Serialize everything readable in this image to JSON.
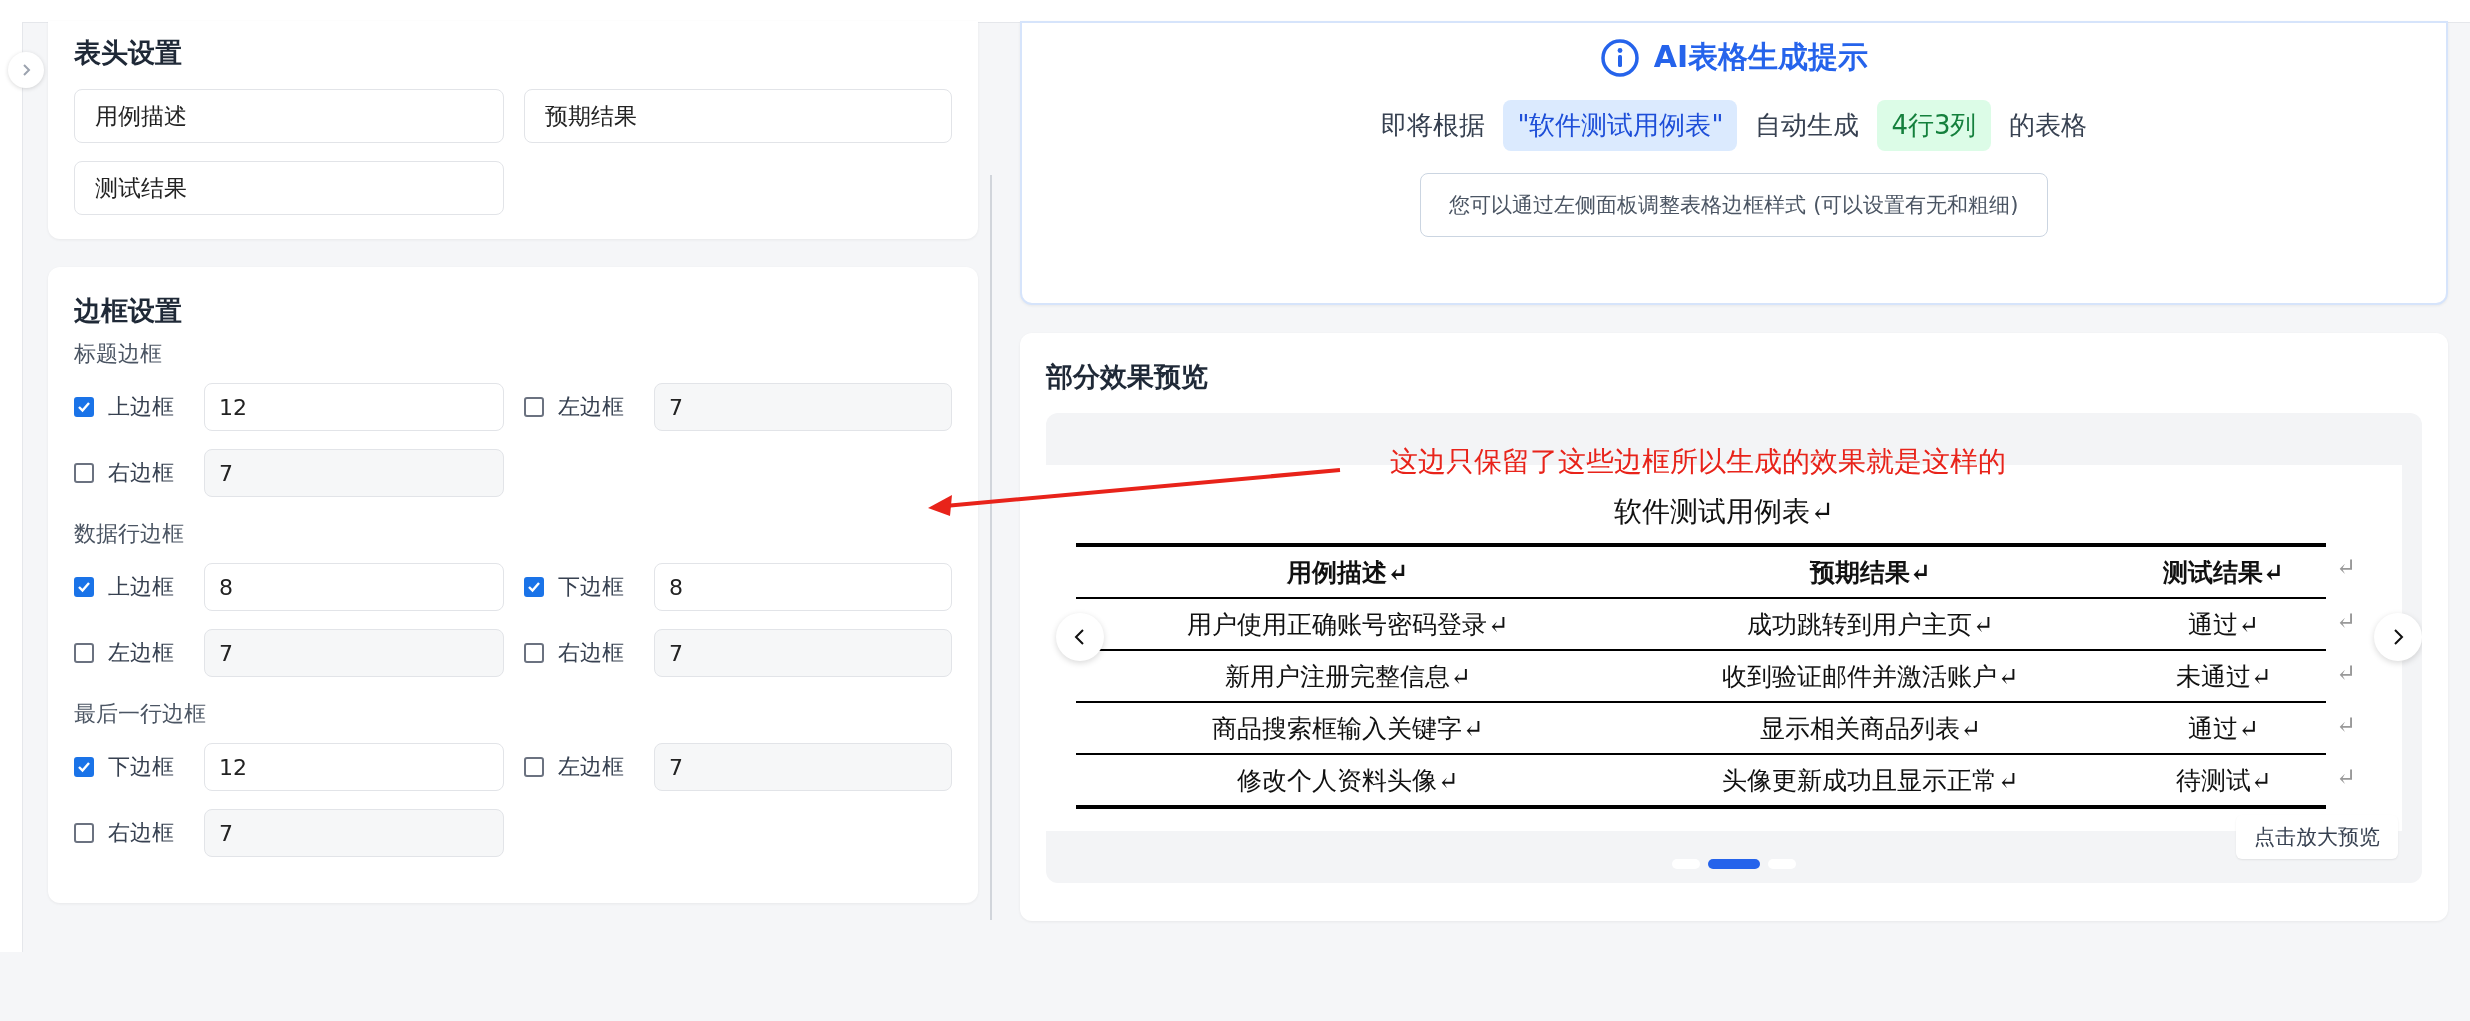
{
  "header_settings": {
    "title": "表头设置",
    "fields": [
      {
        "value": "用例描述"
      },
      {
        "value": "预期结果"
      },
      {
        "value": "测试结果"
      }
    ]
  },
  "border_settings": {
    "title": "边框设置",
    "groups": [
      {
        "label": "标题边框",
        "items": [
          {
            "label": "上边框",
            "checked": true,
            "value": "12"
          },
          {
            "label": "左边框",
            "checked": false,
            "value": "7"
          },
          {
            "label": "右边框",
            "checked": false,
            "value": "7"
          }
        ]
      },
      {
        "label": "数据行边框",
        "items": [
          {
            "label": "上边框",
            "checked": true,
            "value": "8"
          },
          {
            "label": "下边框",
            "checked": true,
            "value": "8"
          },
          {
            "label": "左边框",
            "checked": false,
            "value": "7"
          },
          {
            "label": "右边框",
            "checked": false,
            "value": "7"
          }
        ]
      },
      {
        "label": "最后一行边框",
        "items": [
          {
            "label": "下边框",
            "checked": true,
            "value": "12"
          },
          {
            "label": "左边框",
            "checked": false,
            "value": "7"
          },
          {
            "label": "右边框",
            "checked": false,
            "value": "7"
          }
        ]
      }
    ]
  },
  "ai_hint": {
    "title": "AI表格生成提示",
    "prefix": "即将根据",
    "table_name": "\"软件测试用例表\"",
    "middle": "自动生成",
    "size": "4行3列",
    "suffix": "的表格",
    "note": "您可以通过左侧面板调整表格边框样式 (可以设置有无和粗细)"
  },
  "preview": {
    "title": "部分效果预览",
    "annotation": "这边只保留了这些边框所以生成的效果就是这样的",
    "document": {
      "title": "软件测试用例表↵",
      "columns": [
        "用例描述↵",
        "预期结果↵",
        "测试结果↵"
      ],
      "header_end": "↵",
      "rows": [
        {
          "cells": [
            "用户使用正确账号密码登录↵",
            "成功跳转到用户主页↵",
            "通过↵"
          ],
          "end": "↵"
        },
        {
          "cells": [
            "新用户注册完整信息↵",
            "收到验证邮件并激活账户↵",
            "未通过↵"
          ],
          "end": "↵"
        },
        {
          "cells": [
            "商品搜索框输入关键字↵",
            "显示相关商品列表↵",
            "通过↵"
          ],
          "end": "↵"
        },
        {
          "cells": [
            "修改个人资料头像↵",
            "头像更新成功且显示正常↵",
            "待测试↵"
          ],
          "end": "↵"
        }
      ]
    },
    "slides": [
      {
        "selected": false
      },
      {
        "selected": true
      },
      {
        "selected": false
      }
    ],
    "zoom_button": "点击放大预览"
  }
}
